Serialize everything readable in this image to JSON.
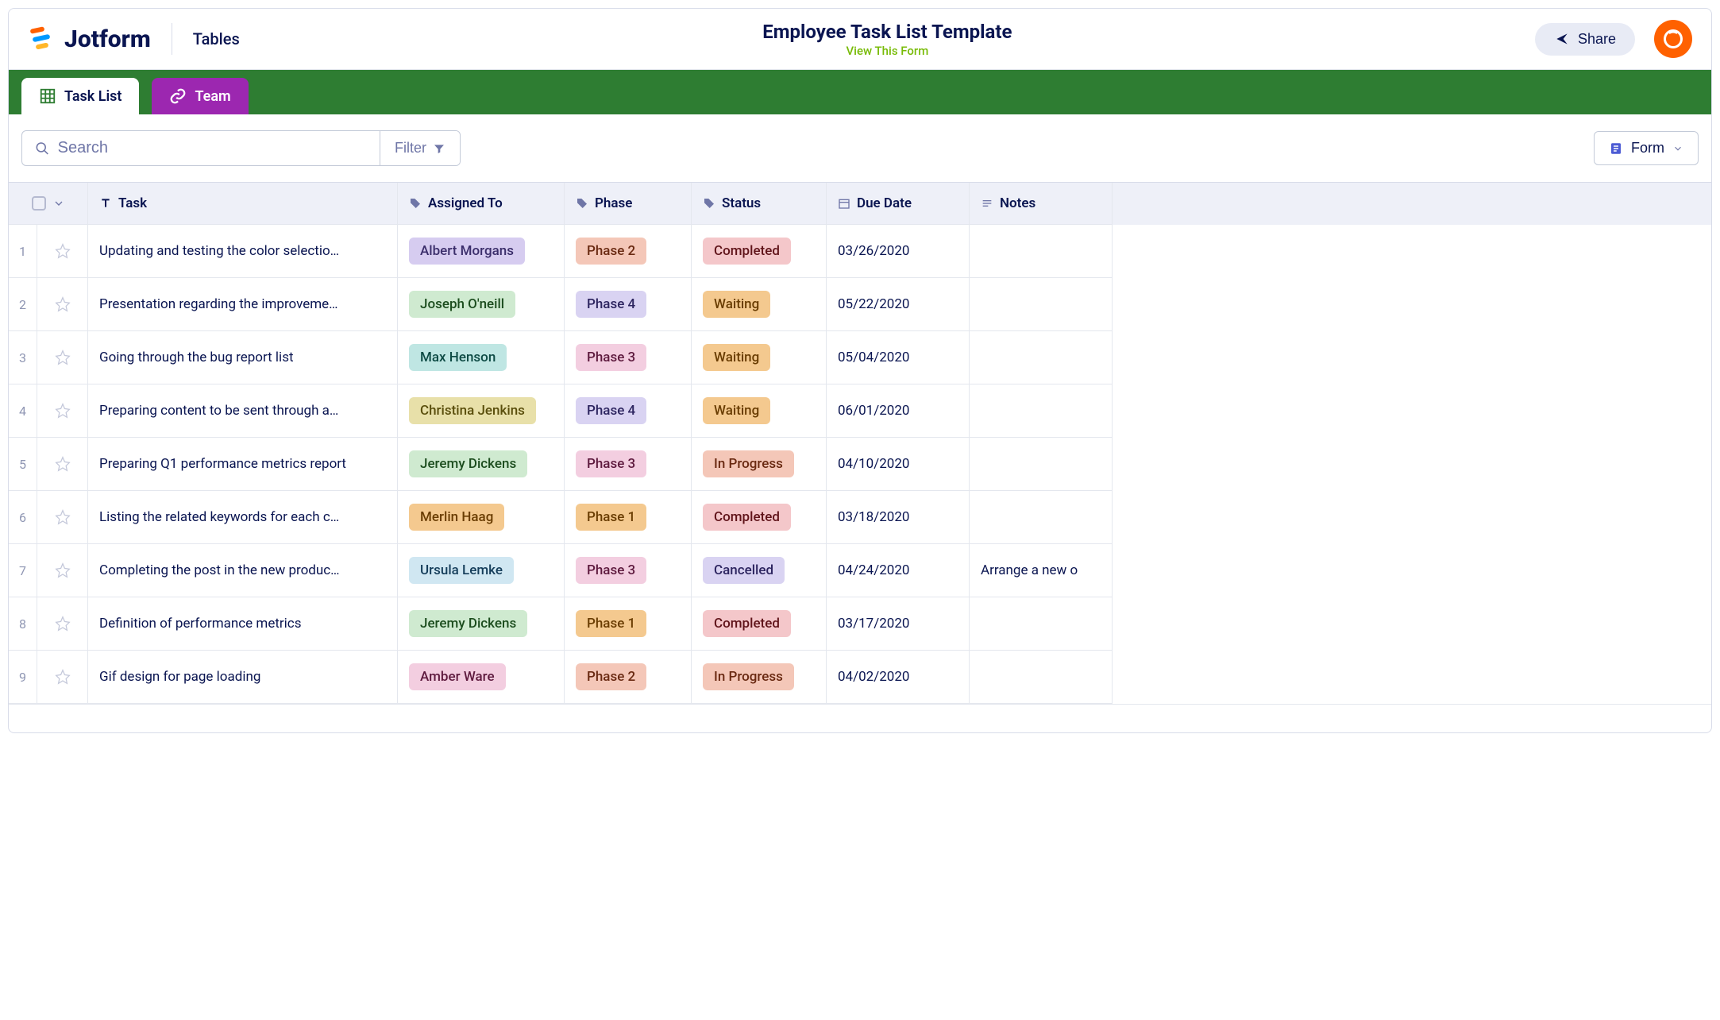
{
  "header": {
    "brand": "Jotform",
    "section": "Tables",
    "title": "Employee Task List Template",
    "view_link": "View This Form",
    "share_label": "Share"
  },
  "tabs": [
    {
      "label": "Task List",
      "active": true
    },
    {
      "label": "Team",
      "active": false
    }
  ],
  "toolbar": {
    "search_placeholder": "Search",
    "filter_label": "Filter",
    "view_label": "Form"
  },
  "columns": {
    "task": "Task",
    "assigned": "Assigned To",
    "phase": "Phase",
    "status": "Status",
    "due": "Due Date",
    "notes": "Notes"
  },
  "rows": [
    {
      "n": "1",
      "task": "Updating and testing the color selectio…",
      "assignee": {
        "name": "Albert Morgans",
        "c": "c-purple-lt"
      },
      "phase": {
        "name": "Phase 2",
        "c": "c-peach"
      },
      "status": {
        "name": "Completed",
        "c": "c-rose"
      },
      "due": "03/26/2020",
      "notes": ""
    },
    {
      "n": "2",
      "task": "Presentation regarding the improveme…",
      "assignee": {
        "name": "Joseph O'neill",
        "c": "c-green-lt"
      },
      "phase": {
        "name": "Phase 4",
        "c": "c-lav"
      },
      "status": {
        "name": "Waiting",
        "c": "c-orange-lt"
      },
      "due": "05/22/2020",
      "notes": ""
    },
    {
      "n": "3",
      "task": "Going through the bug report list",
      "assignee": {
        "name": "Max Henson",
        "c": "c-teal-lt"
      },
      "phase": {
        "name": "Phase 3",
        "c": "c-pink-lt"
      },
      "status": {
        "name": "Waiting",
        "c": "c-orange-lt"
      },
      "due": "05/04/2020",
      "notes": ""
    },
    {
      "n": "4",
      "task": "Preparing content to be sent through a…",
      "assignee": {
        "name": "Christina Jenkins",
        "c": "c-yellow-lt"
      },
      "phase": {
        "name": "Phase 4",
        "c": "c-lav"
      },
      "status": {
        "name": "Waiting",
        "c": "c-orange-lt"
      },
      "due": "06/01/2020",
      "notes": ""
    },
    {
      "n": "5",
      "task": "Preparing Q1 performance metrics report",
      "assignee": {
        "name": "Jeremy Dickens",
        "c": "c-green-lt"
      },
      "phase": {
        "name": "Phase 3",
        "c": "c-pink-lt"
      },
      "status": {
        "name": "In Progress",
        "c": "c-peach"
      },
      "due": "04/10/2020",
      "notes": ""
    },
    {
      "n": "6",
      "task": "Listing the related keywords for each c…",
      "assignee": {
        "name": "Merlin Haag",
        "c": "c-orange-lt"
      },
      "phase": {
        "name": "Phase 1",
        "c": "c-orange-lt"
      },
      "status": {
        "name": "Completed",
        "c": "c-rose"
      },
      "due": "03/18/2020",
      "notes": ""
    },
    {
      "n": "7",
      "task": "Completing the post in the new produc…",
      "assignee": {
        "name": "Ursula Lemke",
        "c": "c-blue-lt"
      },
      "phase": {
        "name": "Phase 3",
        "c": "c-pink-lt"
      },
      "status": {
        "name": "Cancelled",
        "c": "c-lav"
      },
      "due": "04/24/2020",
      "notes": "Arrange a new o"
    },
    {
      "n": "8",
      "task": "Definition of performance metrics",
      "assignee": {
        "name": "Jeremy Dickens",
        "c": "c-green-lt"
      },
      "phase": {
        "name": "Phase 1",
        "c": "c-orange-lt"
      },
      "status": {
        "name": "Completed",
        "c": "c-rose"
      },
      "due": "03/17/2020",
      "notes": ""
    },
    {
      "n": "9",
      "task": "Gif design for page loading",
      "assignee": {
        "name": "Amber Ware",
        "c": "c-pink-lt"
      },
      "phase": {
        "name": "Phase 2",
        "c": "c-peach"
      },
      "status": {
        "name": "In Progress",
        "c": "c-peach"
      },
      "due": "04/02/2020",
      "notes": ""
    }
  ]
}
